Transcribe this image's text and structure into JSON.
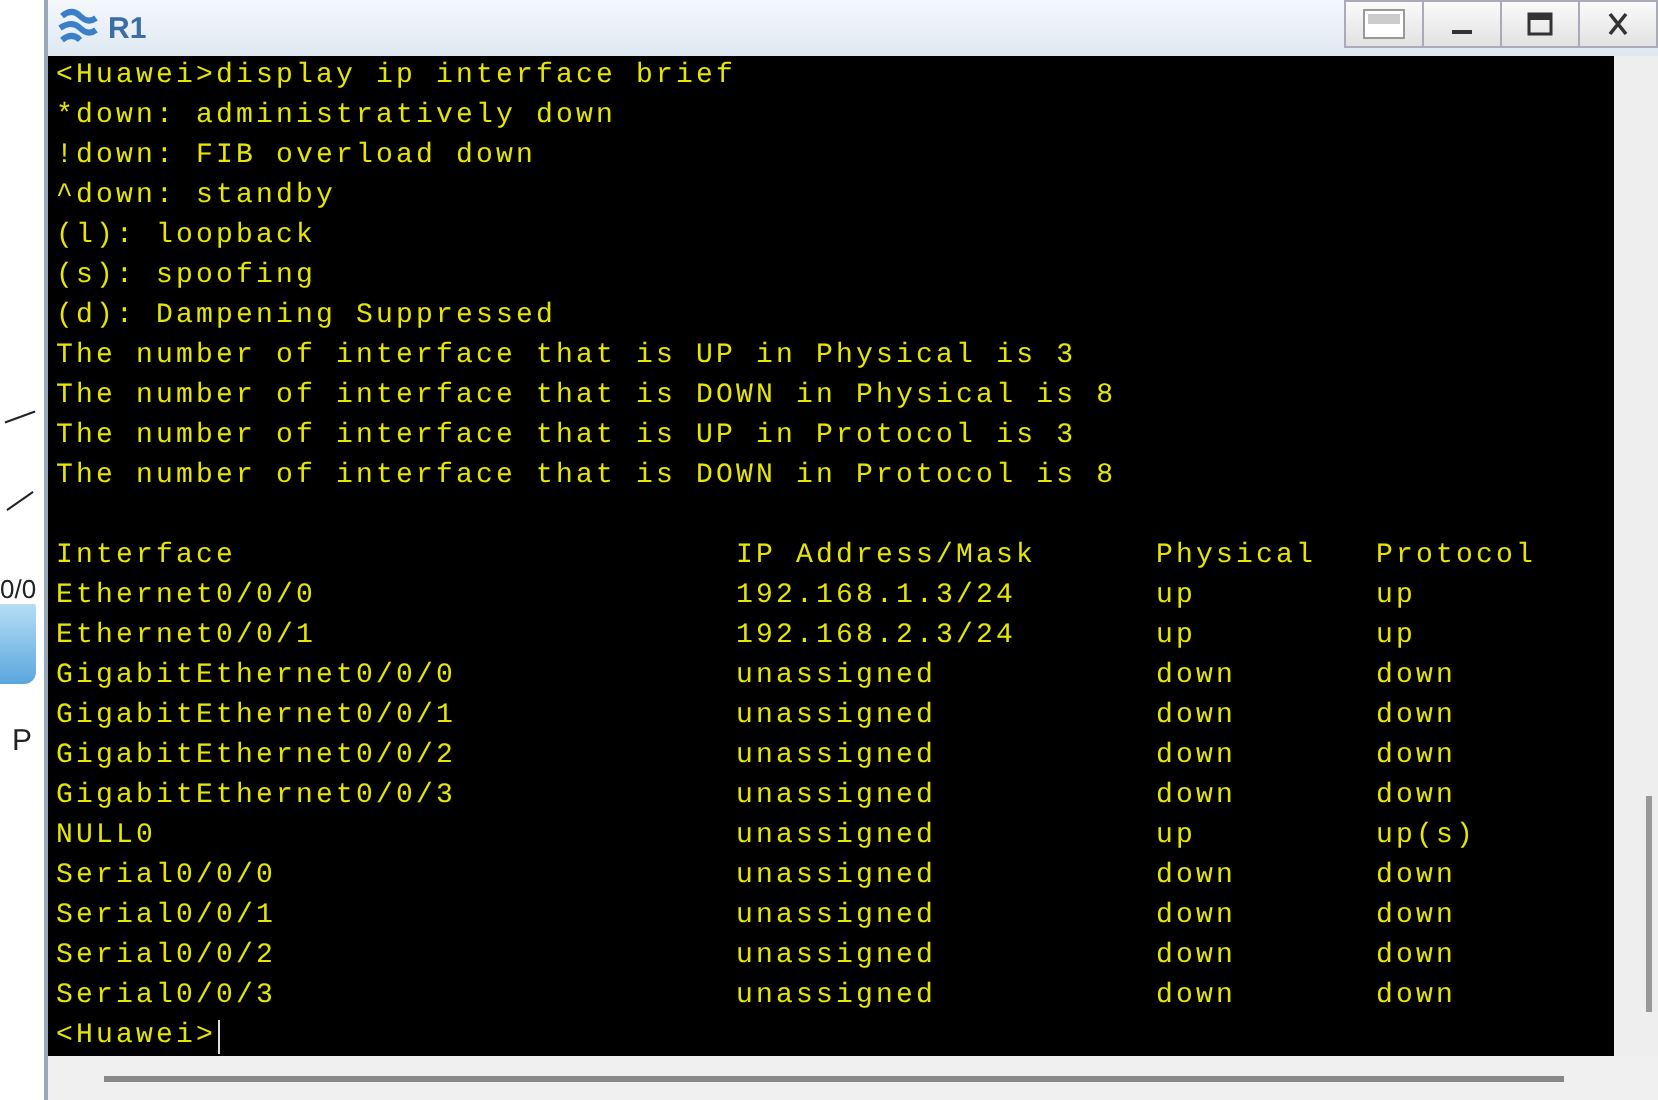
{
  "background_labels": [
    "0/0",
    "P"
  ],
  "window": {
    "title": "R1"
  },
  "terminal": {
    "lines": [
      "<Huawei>display ip interface brief",
      "*down: administratively down",
      "!down: FIB overload down",
      "^down: standby",
      "(l): loopback",
      "(s): spoofing",
      "(d): Dampening Suppressed",
      "The number of interface that is UP in Physical is 3",
      "The number of interface that is DOWN in Physical is 8",
      "The number of interface that is UP in Protocol is 3",
      "The number of interface that is DOWN in Protocol is 8"
    ],
    "table": {
      "columns": [
        "Interface",
        "IP Address/Mask",
        "Physical",
        "Protocol"
      ],
      "rows": [
        [
          "Ethernet0/0/0",
          "192.168.1.3/24",
          "up",
          "up"
        ],
        [
          "Ethernet0/0/1",
          "192.168.2.3/24",
          "up",
          "up"
        ],
        [
          "GigabitEthernet0/0/0",
          "unassigned",
          "down",
          "down"
        ],
        [
          "GigabitEthernet0/0/1",
          "unassigned",
          "down",
          "down"
        ],
        [
          "GigabitEthernet0/0/2",
          "unassigned",
          "down",
          "down"
        ],
        [
          "GigabitEthernet0/0/3",
          "unassigned",
          "down",
          "down"
        ],
        [
          "NULL0",
          "unassigned",
          "up",
          "up(s)"
        ],
        [
          "Serial0/0/0",
          "unassigned",
          "down",
          "down"
        ],
        [
          "Serial0/0/1",
          "unassigned",
          "down",
          "down"
        ],
        [
          "Serial0/0/2",
          "unassigned",
          "down",
          "down"
        ],
        [
          "Serial0/0/3",
          "unassigned",
          "down",
          "down"
        ]
      ]
    },
    "prompt": "<Huawei>"
  }
}
